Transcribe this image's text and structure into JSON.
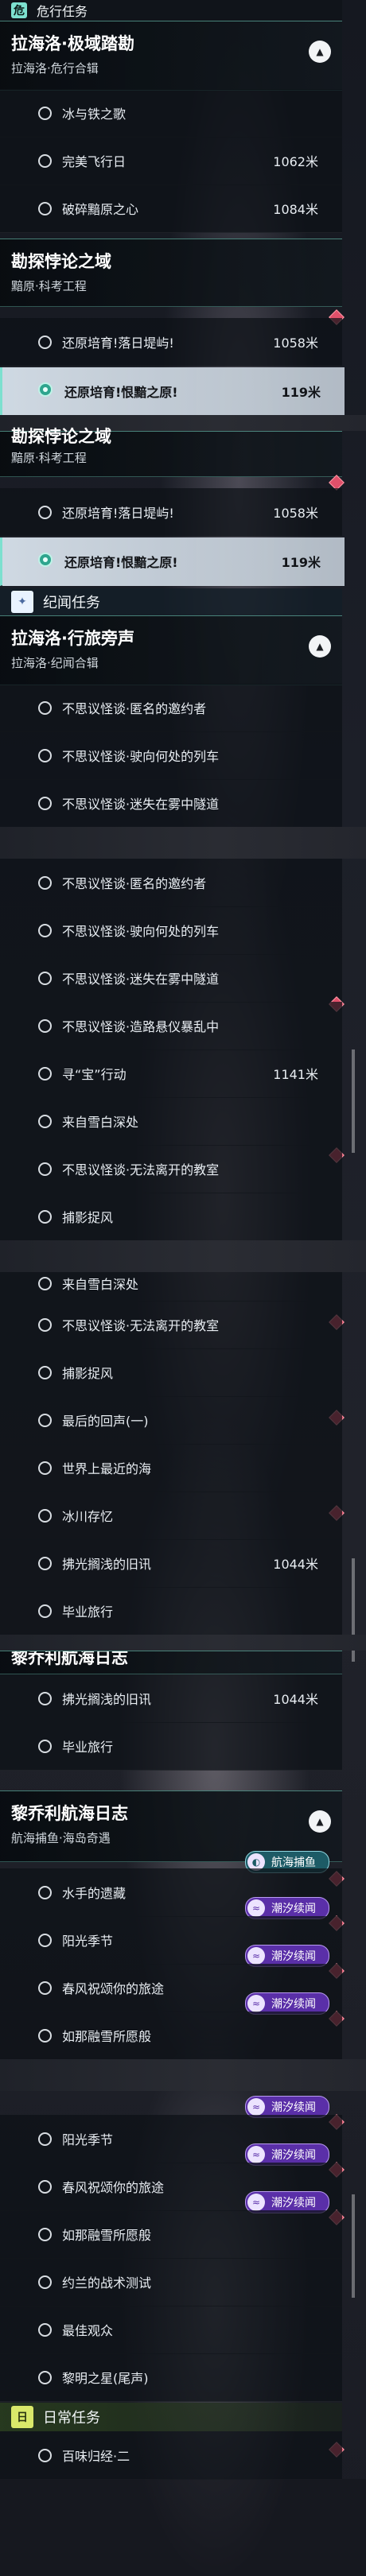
{
  "danger_section": {
    "icon": "危",
    "title": "危行任务"
  },
  "explore_section": {
    "icon": "✦",
    "title": "纪闻任务"
  },
  "daily_section": {
    "icon": "日",
    "title": "日常任务"
  },
  "q_lahailuo_jiyu": {
    "title": "拉海洛·极域踏勘",
    "subtitle": "拉海洛·危行合辑"
  },
  "q_kantan": {
    "title": "勘探悖论之域",
    "subtitle": "黯原·科考工程"
  },
  "q_kantan_partial": {
    "title": "勘探悖论之域",
    "subtitle": "黯原·科考工程"
  },
  "q_lahailuo_lvpang": {
    "title": "拉海洛·行旅旁声",
    "subtitle": "拉海洛·纪闻合辑"
  },
  "q_liqiaoli_partial": {
    "title": "黎乔利航海日志"
  },
  "q_liqiaoli": {
    "title": "黎乔利航海日志",
    "subtitle": "航海捕鱼·海岛奇遇"
  },
  "items": {
    "bingyutie": "冰与铁之歌",
    "wanmei": "完美飞行日",
    "posui": "破碎黯原之心",
    "luori": "还原培育!落日堤屿!",
    "henyuan": "还原培育!恨黯之原!",
    "niming": "不思议怪谈·匿名的邀约者",
    "lieche": "不思议怪谈·驶向何处的列车",
    "miwu": "不思议怪谈·迷失在雾中隧道",
    "zaolu": "不思议怪谈·造路悬仪暴乱中",
    "xunbao": "寻“宝”行动",
    "xueyuan": "来自雪白深处",
    "jiaoshi": "不思议怪谈·无法离开的教室",
    "bufeng": "捕影捉风",
    "huisheng": "最后的回声(一)",
    "zuiyuan": "世界上最近的海",
    "binghe": "冰川存忆",
    "jiuxun": "拂光搁浅的旧讯",
    "biye": "毕业旅行",
    "shuishou": "水手的遗藏",
    "yangguang": "阳光季节",
    "chunfeng": "春风祝颂你的旅途",
    "jinbian": "如那融雪所愿般",
    "zhanshu": "约兰的战术测试",
    "zuijia": "最佳观众",
    "liming": "黎明之星(尾声)",
    "baichuan": "百味归经·二"
  },
  "dist": {
    "d1062": "1062米",
    "d1084": "1084米",
    "d1058": "1058米",
    "d119": "119米",
    "d1141": "1141米",
    "d1044": "1044米"
  },
  "badges": {
    "chaoxi": "潮汐续闻",
    "hanghai": "航海捕鱼"
  },
  "icons": {
    "collapse": "chevron-up-icon",
    "alert": "diamond-alert-icon",
    "track": "target-icon"
  },
  "colors": {
    "accent": "#7de0cf",
    "alert": "#e0506a",
    "badge_purple": "#5a2fa8",
    "badge_teal": "#1d5b66"
  }
}
